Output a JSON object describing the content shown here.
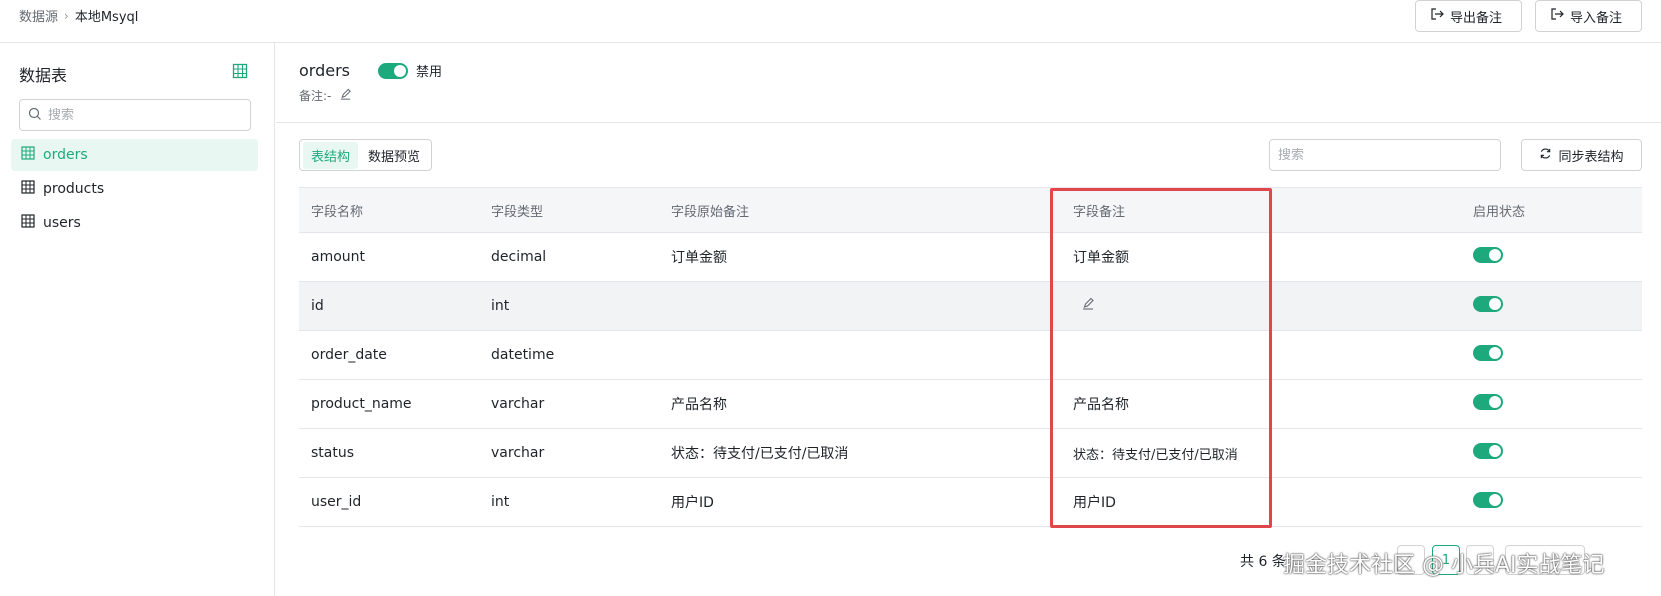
{
  "breadcrumb": {
    "root": "数据源",
    "separator": "›",
    "current": "本地Msyql"
  },
  "toolbar": {
    "export_label": "导出备注",
    "import_label": "导入备注"
  },
  "sidebar": {
    "title": "数据表",
    "search_placeholder": "搜索",
    "items": [
      {
        "label": "orders",
        "active": true
      },
      {
        "label": "products",
        "active": false
      },
      {
        "label": "users",
        "active": false
      }
    ]
  },
  "table_header": {
    "name": "orders",
    "toggle_label": "禁用",
    "remark": "备注:-"
  },
  "tabs": [
    {
      "label": "表结构",
      "active": true
    },
    {
      "label": "数据预览",
      "active": false
    }
  ],
  "table_search_placeholder": "搜索",
  "sync_label": "同步表结构",
  "columns": [
    "字段名称",
    "字段类型",
    "字段原始备注",
    "字段备注",
    "启用状态"
  ],
  "rows": [
    {
      "name": "amount",
      "type": "decimal",
      "original": "订单金额",
      "remark": "订单金额",
      "enabled": true
    },
    {
      "name": "id",
      "type": "int",
      "original": "",
      "remark": "",
      "enabled": true,
      "editing": true
    },
    {
      "name": "order_date",
      "type": "datetime",
      "original": "",
      "remark": "",
      "enabled": true
    },
    {
      "name": "product_name",
      "type": "varchar",
      "original": "产品名称",
      "remark": "产品名称",
      "enabled": true
    },
    {
      "name": "status",
      "type": "varchar",
      "original": "状态：待支付/已支付/已取消",
      "remark": "状态：待支付/已支付/已取消",
      "enabled": true
    },
    {
      "name": "user_id",
      "type": "int",
      "original": "用户ID",
      "remark": "用户ID",
      "enabled": true
    }
  ],
  "pagination": {
    "total_text": "共 6 条",
    "current_page": "1"
  },
  "watermark": "掘金技术社区 @ 小兵AI实战笔记",
  "colors": {
    "accent": "#1ea97c",
    "highlight": "#e0474c"
  }
}
